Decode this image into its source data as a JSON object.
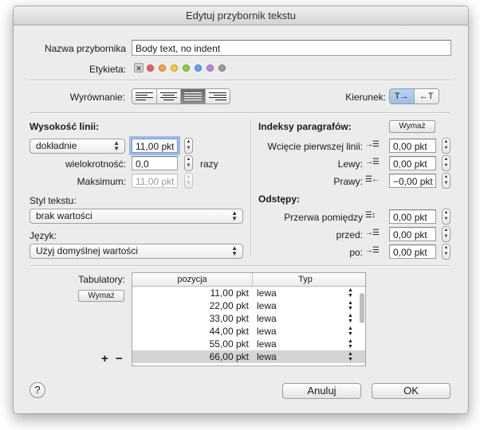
{
  "window": {
    "title": "Edytuj przybornik tekstu"
  },
  "name": {
    "label": "Nazwa przybornika",
    "value": "Body text, no indent"
  },
  "tags": {
    "label": "Etykieta:",
    "clear_glyph": "✕",
    "colors": [
      "#f25e5c",
      "#f8a33c",
      "#f3d32f",
      "#8ad23d",
      "#5aa6f5",
      "#c483dd",
      "#9f9f9f"
    ]
  },
  "alignment": {
    "label": "Wyrównanie:",
    "selected_index": 2
  },
  "direction": {
    "label": "Kierunek:",
    "ltr": "T→",
    "rtl": "←T"
  },
  "line_height": {
    "title": "Wysokość linii:",
    "mode": "dokładnie",
    "value": "11,00 pkt",
    "multiple_label": "wielokrotność:",
    "multiple_value": "0,0",
    "multiple_unit": "razy",
    "max_label": "Maksimum:",
    "max_value": "11,00 pkt"
  },
  "text_style": {
    "label": "Styl tekstu:",
    "value": "brak wartości"
  },
  "language": {
    "label": "Język:",
    "value": "Użyj domyślnej wartości"
  },
  "indents": {
    "title": "Indeksy paragrafów:",
    "clear_label": "Wymaż",
    "first_line_label": "Wcięcie pierwszej linii:",
    "first_line_value": "0,00 pkt",
    "left_label": "Lewy:",
    "left_value": "0,00 pkt",
    "right_label": "Prawy:",
    "right_value": "−0,00 pkt"
  },
  "spacing": {
    "title": "Odstępy:",
    "between_label": "Przerwa pomiędzy",
    "between_value": "0,00 pkt",
    "before_label": "przed:",
    "before_value": "0,00 pkt",
    "after_label": "po:",
    "after_value": "0,00 pkt"
  },
  "tabs": {
    "label": "Tabulatory:",
    "clear_label": "Wymaż",
    "add_glyph": "+",
    "remove_glyph": "−",
    "col_position": "pozycja",
    "col_type": "Typ",
    "rows": [
      {
        "pos": "11,00 pkt",
        "type": "lewa"
      },
      {
        "pos": "22,00 pkt",
        "type": "lewa"
      },
      {
        "pos": "33,00 pkt",
        "type": "lewa"
      },
      {
        "pos": "44,00 pkt",
        "type": "lewa"
      },
      {
        "pos": "55,00 pkt",
        "type": "lewa"
      },
      {
        "pos": "66,00 pkt",
        "type": "lewa"
      }
    ],
    "selected_row": 5
  },
  "footer": {
    "help": "?",
    "cancel": "Anuluj",
    "ok": "OK"
  }
}
